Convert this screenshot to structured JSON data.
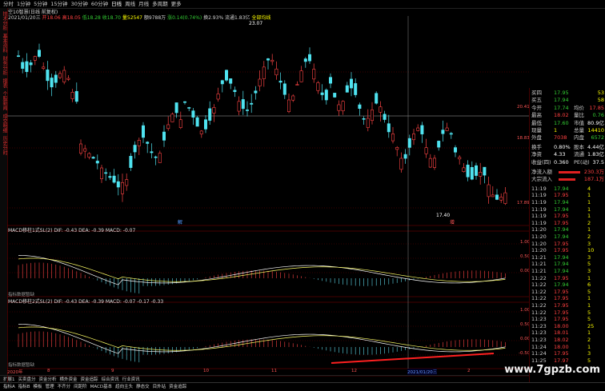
{
  "toolbar": {
    "items": [
      "分时",
      "1分钟",
      "5分钟",
      "15分钟",
      "30分钟",
      "60分钟",
      "日线",
      "周线",
      "月线",
      "多周期",
      "更多"
    ],
    "active_index": 6
  },
  "left_strip": [
    "技术分析",
    "基本资料",
    "财务分析",
    "报表",
    "个股新闻",
    "成交明细",
    "历史分时"
  ],
  "header": {
    "line1": "空10智慧(日线 前复权)",
    "line2_segments": [
      {
        "text": "2021/01/20三",
        "color": "#d0d0d0"
      },
      {
        "text": "开18.06",
        "color": "#ff4040"
      },
      {
        "text": "高18.05",
        "color": "#ff4040"
      },
      {
        "text": "低18.28",
        "color": "#33cc33"
      },
      {
        "text": "收18.70",
        "color": "#33cc33"
      },
      {
        "text": "量52547",
        "color": "#ffff00"
      },
      {
        "text": "额9788万",
        "color": "#d0d0d0"
      },
      {
        "text": "涨0.14(0.74%)",
        "color": "#33cc33"
      },
      {
        "text": "换2.93%",
        "color": "#d0d0d0"
      },
      {
        "text": "流通1.83亿",
        "color": "#d0d0d0"
      },
      {
        "text": "全部均线",
        "color": "#ffff00"
      }
    ]
  },
  "main_chart": {
    "hi_label": "23.07",
    "lo_label": "17.40",
    "price_axis": [
      "20.41",
      "18.83",
      "17.89"
    ],
    "markers": [
      "解",
      "增"
    ]
  },
  "macd1": {
    "header": "MACD移柱1式SL(2) DIF: -0.43  DEA: -0.39  MACD: -0.07",
    "dif_color": "#ffffff",
    "dea_color": "#ffff00",
    "macd_color": "#ff44ff",
    "axis": [
      "1.00",
      "0.50",
      "0.00"
    ],
    "footnote": "指标数据暂缺"
  },
  "macd2": {
    "header": "MACD移柱2式SL(2) DIF: -0.43  DEA: -0.39  MACD: -0.07  -0.17  -0.33",
    "axis": [
      "1.00",
      "0.50",
      "0.00",
      "-0.50"
    ],
    "footnote": "指标数据暂缺"
  },
  "date_axis": [
    "2020年",
    "8",
    "9",
    "10",
    "11",
    "12",
    "2021/01/20三",
    "2"
  ],
  "quote": {
    "rows": [
      {
        "l": "买四",
        "v": "17.95",
        "vc": "#33cc33",
        "r": "53",
        "rc": "#ffff00"
      },
      {
        "l": "买五",
        "v": "17.94",
        "vc": "#33cc33",
        "r": "58",
        "rc": "#ffff00"
      },
      {
        "l": "今开",
        "v": "17.74",
        "vc": "#33cc33",
        "l2": "均价",
        "r": "17.85",
        "rc": "#ff4040"
      },
      {
        "l": "最高",
        "v": "18.02",
        "vc": "#ff4040",
        "l2": "量比",
        "r": "0.76",
        "rc": "#33cc33"
      },
      {
        "l": "最低",
        "v": "17.60",
        "vc": "#33cc33",
        "l2": "市值",
        "r": "80.9亿",
        "rc": "#ffffff"
      },
      {
        "l": "现量",
        "v": "1",
        "vc": "#ffff00",
        "l2": "总量",
        "r": "14410",
        "rc": "#ffff00"
      },
      {
        "l": "外盘",
        "v": "7038",
        "vc": "#ff4040",
        "l2": "内盘",
        "r": "6572",
        "rc": "#33cc33"
      },
      {
        "l": "换手",
        "v": "0.80%",
        "vc": "#ffffff",
        "l2": "股本",
        "r": "4.44亿",
        "rc": "#ffffff"
      },
      {
        "l": "净资",
        "v": "4.33",
        "vc": "#ffffff",
        "l2": "流通",
        "r": "1.83亿",
        "rc": "#ffffff"
      },
      {
        "l": "收益(四)",
        "v": "0.360",
        "vc": "#ffffff",
        "l2": "PE(动)",
        "r": "37.5",
        "rc": "#ffffff"
      }
    ],
    "flows": [
      {
        "l": "净流入额",
        "v": "230.3万",
        "vc": "#ff4040",
        "bar": 0.9
      },
      {
        "l": "大宗流入",
        "v": "187.1万",
        "vc": "#ff4040",
        "bar": 0.7
      }
    ],
    "ticks": [
      [
        "11:19",
        "17.94",
        "4"
      ],
      [
        "11:19",
        "17.95",
        "1"
      ],
      [
        "11:19",
        "17.94",
        "1"
      ],
      [
        "11:19",
        "17.94",
        "1"
      ],
      [
        "11:19",
        "17.95",
        "1"
      ],
      [
        "11:19",
        "17.95",
        "2"
      ],
      [
        "11:20",
        "17.94",
        "1"
      ],
      [
        "11:20",
        "17.94",
        "2"
      ],
      [
        "11:20",
        "17.95",
        "3"
      ],
      [
        "11:20",
        "17.95",
        "10"
      ],
      [
        "11:21",
        "17.94",
        "3"
      ],
      [
        "11:21",
        "17.94",
        "5"
      ],
      [
        "11:21",
        "17.94",
        "3"
      ],
      [
        "11:22",
        "17.95",
        "1"
      ],
      [
        "11:22",
        "17.94",
        "6"
      ],
      [
        "11:22",
        "17.95",
        "5"
      ],
      [
        "11:22",
        "17.95",
        "1"
      ],
      [
        "11:22",
        "17.95",
        "1"
      ],
      [
        "11:22",
        "17.95",
        "5"
      ],
      [
        "11:23",
        "17.95",
        "5"
      ],
      [
        "11:23",
        "18.00",
        "25"
      ],
      [
        "11:23",
        "18.01",
        "1"
      ],
      [
        "11:23",
        "18.02",
        "2"
      ],
      [
        "11:24",
        "18.00",
        "1"
      ],
      [
        "11:24",
        "17.95",
        "3"
      ],
      [
        "11:25",
        "17.97",
        "5"
      ]
    ]
  },
  "bottombar": [
    "指标A",
    "指标B",
    "模板",
    "管理",
    "不齐分",
    "间距阶",
    "MACD基本",
    "趋向主头",
    "静态交",
    "目外站",
    "资金追踪"
  ],
  "bottombar2": [
    "扩展1",
    "买卖盘分",
    "资金分析",
    "横外资金",
    "资金追踪",
    "综合资讯",
    "行业资讯"
  ],
  "watermark": "www.7gpzb.com"
}
